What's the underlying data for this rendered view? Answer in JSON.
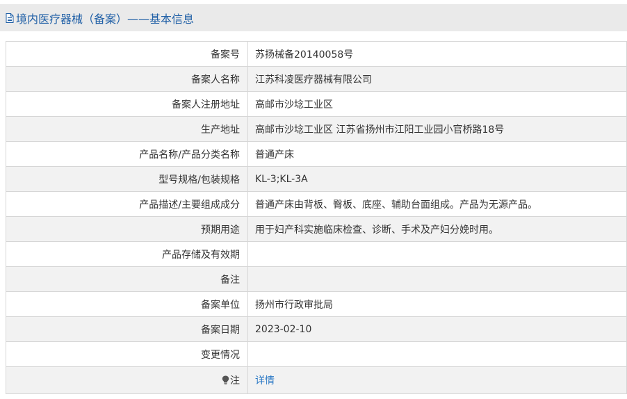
{
  "header": {
    "title": "境内医疗器械（备案）——基本信息",
    "icon": "document-icon"
  },
  "rows": [
    {
      "label": "备案号",
      "value": "苏扬械备20140058号"
    },
    {
      "label": "备案人名称",
      "value": "江苏科凌医疗器械有限公司"
    },
    {
      "label": "备案人注册地址",
      "value": "高邮市沙埝工业区"
    },
    {
      "label": "生产地址",
      "value": "高邮市沙埝工业区 江苏省扬州市江阳工业园小官桥路18号"
    },
    {
      "label": "产品名称/产品分类名称",
      "value": "普通产床"
    },
    {
      "label": "型号规格/包装规格",
      "value": "KL-3;KL-3A"
    },
    {
      "label": "产品描述/主要组成成分",
      "value": "普通产床由背板、臀板、底座、辅助台面组成。产品为无源产品。"
    },
    {
      "label": "预期用途",
      "value": "用于妇产科实施临床检查、诊断、手术及产妇分娩时用。"
    },
    {
      "label": "产品存储及有效期",
      "value": ""
    },
    {
      "label": "备注",
      "value": ""
    },
    {
      "label": "备案单位",
      "value": "扬州市行政审批局"
    },
    {
      "label": "备案日期",
      "value": "2023-02-10"
    },
    {
      "label": "变更情况",
      "value": ""
    }
  ],
  "note_row": {
    "label": "注",
    "icon": "lightbulb-icon",
    "link_text": "详情"
  },
  "colors": {
    "title_text": "#1f5fa6",
    "title_bar_bg": "#eaeaea",
    "link": "#2a78c5",
    "row_alt_bg": "#f2f2f2",
    "border": "#d6d6d6"
  }
}
